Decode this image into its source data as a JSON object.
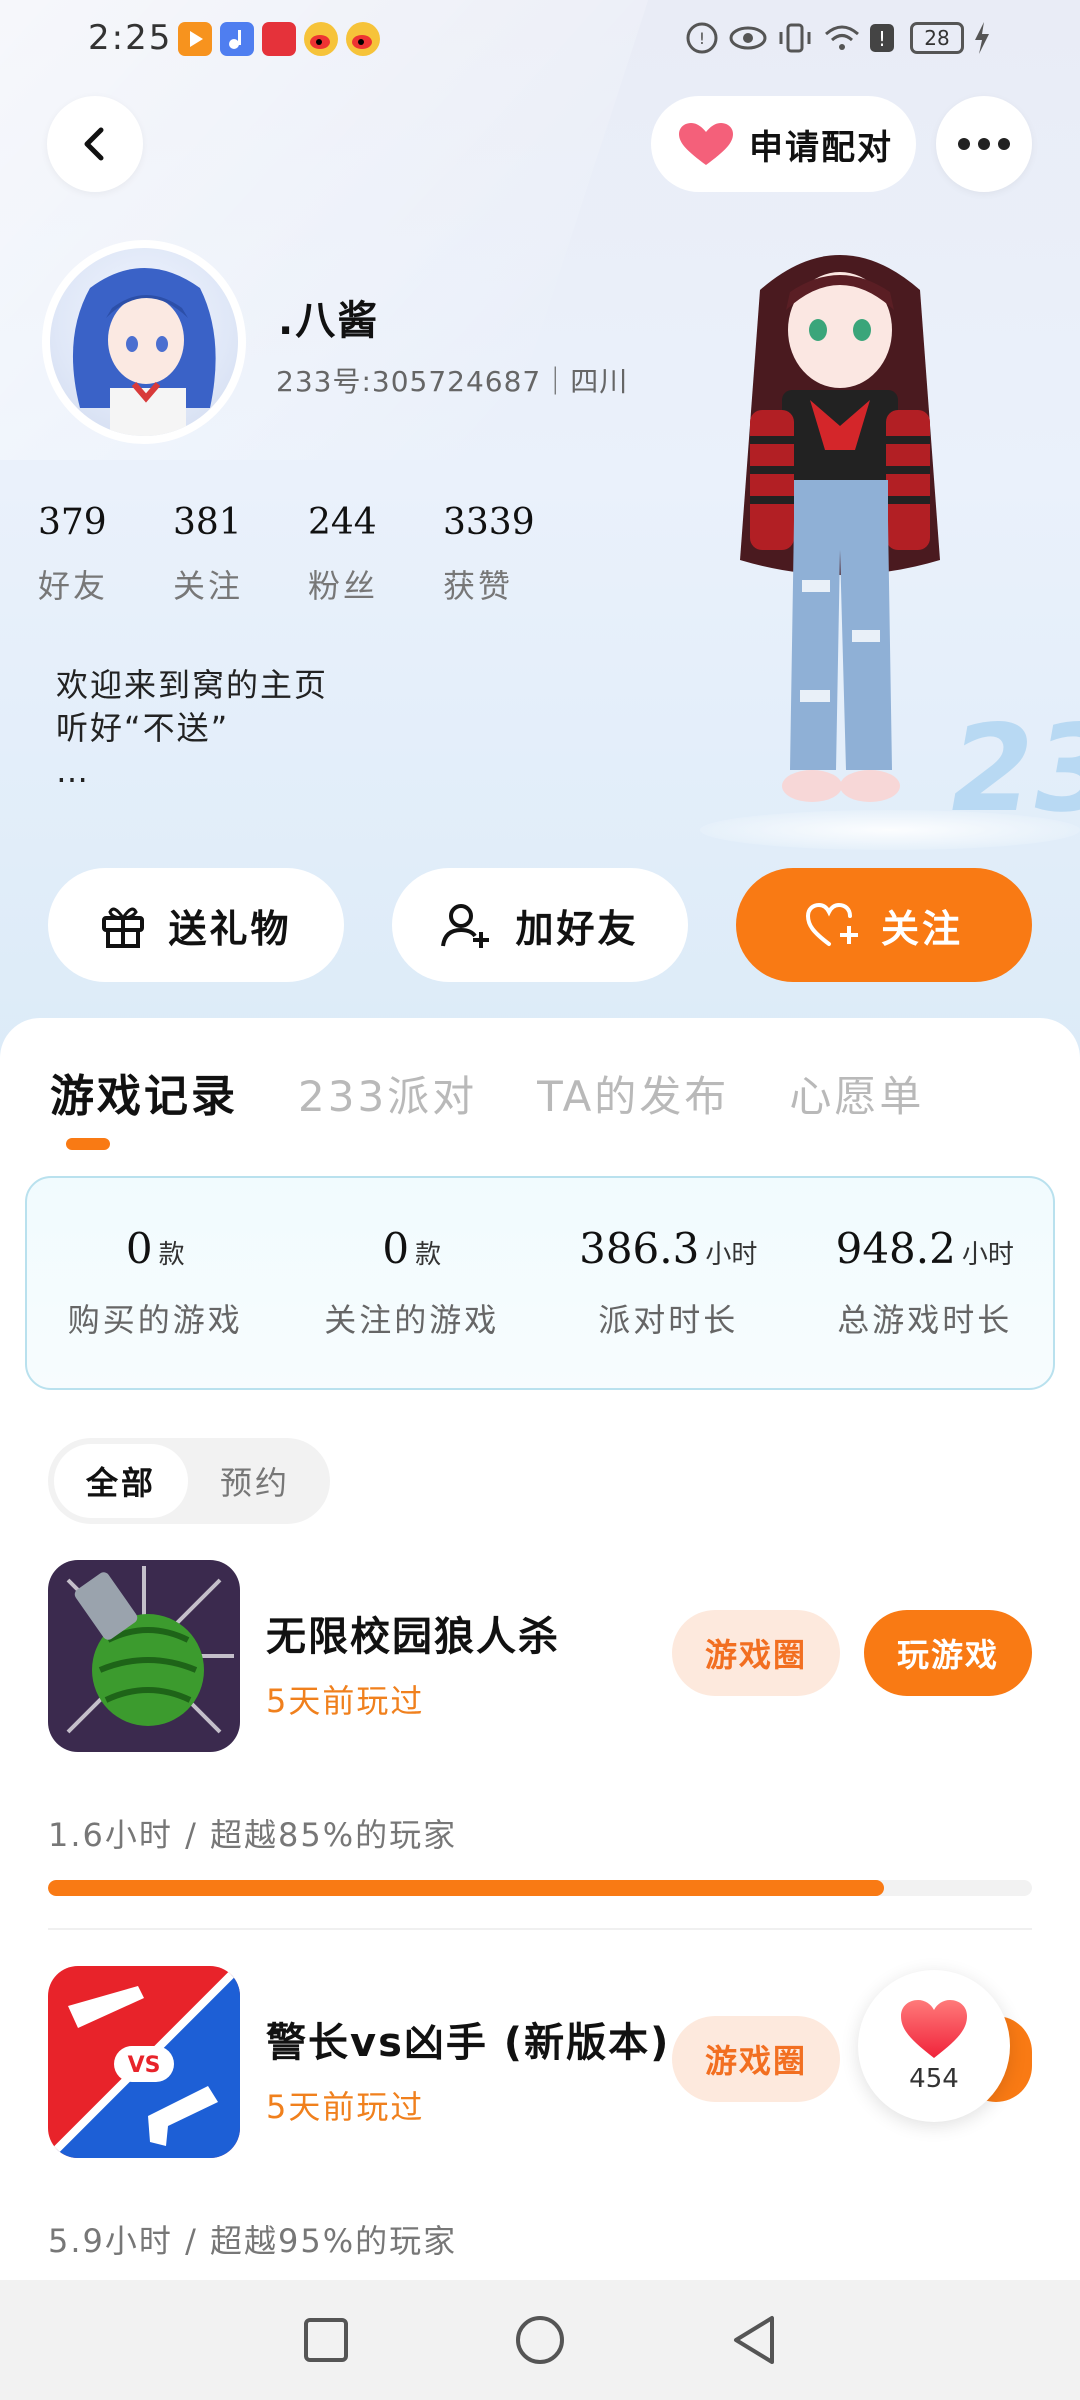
{
  "status_bar": {
    "time": "2:25",
    "battery": "28"
  },
  "header": {
    "pair_label": "申请配对"
  },
  "profile": {
    "nickname": ".八酱",
    "uid_line": "233号:305724687｜四川",
    "stats": [
      {
        "num": "379",
        "label": "好友"
      },
      {
        "num": "381",
        "label": "关注"
      },
      {
        "num": "244",
        "label": "粉丝"
      },
      {
        "num": "3339",
        "label": "获赞"
      }
    ],
    "bio": [
      "欢迎来到窝的主页",
      "听好“不送”",
      "…"
    ]
  },
  "stage_text": "233",
  "actions": {
    "gift": "送礼物",
    "add_friend": "加好友",
    "follow": "关注"
  },
  "tabs": [
    "游戏记录",
    "233派对",
    "TA的发布",
    "心愿单"
  ],
  "summary": [
    {
      "value": "0",
      "unit": "款",
      "label": "购买的游戏"
    },
    {
      "value": "0",
      "unit": "款",
      "label": "关注的游戏"
    },
    {
      "value": "386.3",
      "unit": "小时",
      "label": "派对时长"
    },
    {
      "value": "948.2",
      "unit": "小时",
      "label": "总游戏时长"
    }
  ],
  "filter": [
    "全部",
    "预约"
  ],
  "games": [
    {
      "title": "无限校园狼人杀",
      "played": "5天前玩过",
      "circle_label": "游戏圈",
      "play_label": "玩游戏",
      "meta": "1.6小时 / 超越85%的玩家",
      "progress_percent": 85
    },
    {
      "title": "警长vs凶手 (新版本)",
      "played": "5天前玩过",
      "circle_label": "游戏圈",
      "icon_text": "VS",
      "meta": "5.9小时 / 超越95%的玩家",
      "progress_percent": 95
    }
  ],
  "like_fab": {
    "count": "454"
  },
  "colors": {
    "accent": "#f97a14",
    "accent_light": "#fde9dd",
    "summary_border": "#b9e1ee"
  }
}
